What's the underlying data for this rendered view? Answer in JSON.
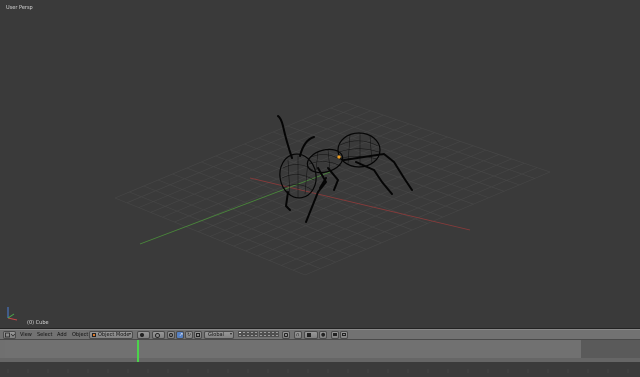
{
  "viewport": {
    "view_name": "User Persp",
    "object_name": "(0) Cube",
    "model": "ant-wireframe-model",
    "colors": {
      "background": "#3a3a3a",
      "grid": "#474747",
      "x_axis": "#8a3a3a",
      "y_axis": "#4a8a3a",
      "wire": "#050505",
      "origin": "#f0a020"
    }
  },
  "header": {
    "editor_type_icon": "3d-view-icon",
    "menus": [
      {
        "label": "View"
      },
      {
        "label": "Select"
      },
      {
        "label": "Add"
      },
      {
        "label": "Object"
      }
    ],
    "mode": {
      "label": "Object Mode",
      "icon": "object-mode-icon"
    },
    "shading_icon": "viewport-shading-icon",
    "pivot_icon": "pivot-point-icon",
    "manipulator_icons": [
      "manipulator-toggle-icon",
      "translate-icon",
      "rotate-icon",
      "scale-icon"
    ],
    "orientation": {
      "label": "Global"
    },
    "layer_count": 20,
    "snap_icons": [
      "lock-icon",
      "snap-toggle-icon",
      "snap-target-icon"
    ],
    "render_icons": [
      "opengl-render-icon",
      "opengl-anim-icon"
    ]
  },
  "timeline": {
    "current_frame": 1,
    "marker_color": "#4bd24b"
  }
}
